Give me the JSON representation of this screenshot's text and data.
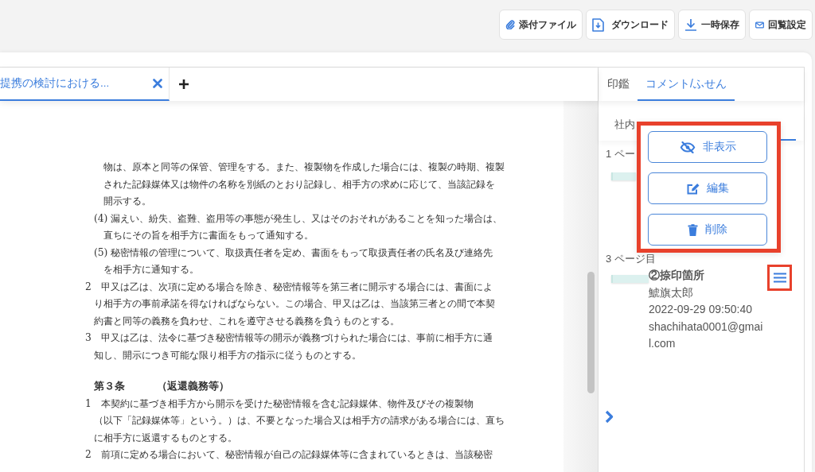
{
  "toolbar": {
    "buttons": [
      {
        "label": "添付ファイル"
      },
      {
        "label": "ダウンロード"
      },
      {
        "label": "一時保存"
      },
      {
        "label": "回覧設定"
      }
    ]
  },
  "document_tabs": [
    {
      "label": "提携の検討における...",
      "selected": true
    }
  ],
  "document": {
    "blocks": [
      {
        "kind": "continuation",
        "lines": [
          "物は、原本と同等の保管、管理をする。また、複製物を作成した場合には、複製の時期、複製",
          "された記録媒体又は物件の名称を別紙のとおり記録し、相手方の求めに応じて、当該記録を",
          "開示する。"
        ]
      },
      {
        "kind": "item",
        "lines": [
          "(4) 漏えい、紛失、盗難、盗用等の事態が発生し、又はそのおそれがあることを知った場合は、",
          "直ちにその旨を相手方に書面をもって通知する。"
        ]
      },
      {
        "kind": "item",
        "lines": [
          "(5) 秘密情報の管理について、取扱責任者を定め、書面をもって取扱責任者の氏名及び連絡先",
          "を相手方に通知する。"
        ]
      },
      {
        "kind": "clause",
        "lines": [
          "2　甲又は乙は、次項に定める場合を除き、秘密情報等を第三者に開示する場合には、書面によ",
          "り相手方の事前承諾を得なければならない。この場合、甲又は乙は、当該第三者との間で本契",
          "約書と同等の義務を負わせ、これを遵守させる義務を負うものとする。"
        ]
      },
      {
        "kind": "clause",
        "lines": [
          "3　甲又は乙は、法令に基づき秘密情報等の開示が義務づけられた場合には、事前に相手方に通",
          "知し、開示につき可能な限り相手方の指示に従うものとする。"
        ]
      },
      {
        "kind": "heading",
        "number": "第３条",
        "title": "（返還義務等）"
      },
      {
        "kind": "clause",
        "lines": [
          "1　本契約に基づき相手方から開示を受けた秘密情報を含む記録媒体、物件及びその複製物",
          "（以下「記録媒体等」という。）は、不要となった場合又は相手方の請求がある場合には、直ち",
          "に相手方に返還するものとする。"
        ]
      },
      {
        "kind": "clause",
        "lines": [
          "2　前項に定める場合において、秘密情報が自己の記録媒体等に含まれているときは、当該秘密"
        ]
      }
    ]
  },
  "side_panel": {
    "tabs": [
      {
        "label": "印鑑",
        "selected": false
      },
      {
        "label": "コメント/ふせん",
        "selected": true
      }
    ],
    "sub_tabs": [
      {
        "label": "社内",
        "selected": false
      },
      {
        "selected": true
      }
    ],
    "pages": [
      {
        "label": "1 ペー"
      },
      {
        "label": "3 ページ目",
        "comment": {
          "title": "②捺印箇所",
          "author": "鯱旗太郎",
          "date": "2022-09-29 09:50:40",
          "email": "shachihata0001@gmail.com",
          "menu_highlighted": true
        }
      }
    ],
    "popup_menu": {
      "highlighted": true,
      "items": [
        {
          "label": "非表示"
        },
        {
          "label": "編集"
        },
        {
          "label": "削除"
        }
      ]
    }
  }
}
